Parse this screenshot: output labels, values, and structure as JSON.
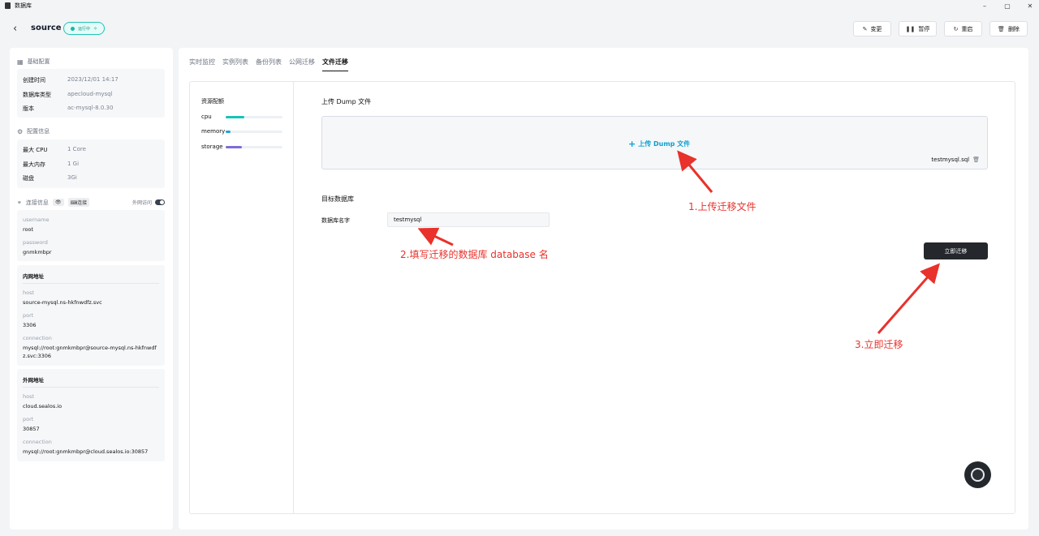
{
  "window": {
    "title": "数据库",
    "controls": [
      "–",
      "▢",
      "✕"
    ]
  },
  "header": {
    "back": "‹",
    "name": "source",
    "status": "运行中"
  },
  "actions": [
    {
      "icon": "✎",
      "label": "变更"
    },
    {
      "icon": "❚❚",
      "label": "暂停"
    },
    {
      "icon": "↻",
      "label": "重启"
    },
    {
      "icon": "🗑",
      "label": "删除"
    }
  ],
  "sidebar": {
    "basic_title": "基础配置",
    "basic": [
      {
        "k": "创建时间",
        "v": "2023/12/01 14:17"
      },
      {
        "k": "数据库类型",
        "v": "apecloud-mysql"
      },
      {
        "k": "版本",
        "v": "ac-mysql-8.0.30"
      }
    ],
    "config_title": "配置信息",
    "config": [
      {
        "k": "最大 CPU",
        "v": "1 Core"
      },
      {
        "k": "最大内存",
        "v": "1 Gi"
      },
      {
        "k": "磁盘",
        "v": "3Gi"
      }
    ],
    "conn_title": "连接信息",
    "connect_label": "连接",
    "external_access": "外网访问",
    "creds": [
      {
        "k": "username",
        "v": "root"
      },
      {
        "k": "password",
        "v": "gnmkmbpr"
      }
    ],
    "internal_title": "内网地址",
    "internal": [
      {
        "k": "host",
        "v": "source-mysql.ns-hkfnwdfz.svc"
      },
      {
        "k": "port",
        "v": "3306"
      },
      {
        "k": "connection",
        "v": "mysql://root:gnmkmbpr@source-mysql.ns-hkfnwdfz.svc:3306"
      }
    ],
    "external_title": "外网地址",
    "external": [
      {
        "k": "host",
        "v": "cloud.sealos.io"
      },
      {
        "k": "port",
        "v": "30857"
      },
      {
        "k": "connection",
        "v": "mysql://root:gnmkmbpr@cloud.sealos.io:30857"
      }
    ]
  },
  "tabs": [
    "实时监控",
    "实例列表",
    "备份列表",
    "公网迁移",
    "文件迁移"
  ],
  "active_tab": "文件迁移",
  "resources": {
    "title": "资源配额",
    "items": [
      {
        "label": "cpu",
        "fraction": 0.33,
        "color": "#16c4b6"
      },
      {
        "label": "memory",
        "fraction": 0.08,
        "color": "#14a8dc"
      },
      {
        "label": "storage",
        "fraction": 0.29,
        "color": "#7c6cd6"
      }
    ]
  },
  "upload": {
    "title": "上传 Dump 文件",
    "link": "上传 Dump 文件",
    "file": "testmysql.sql"
  },
  "target": {
    "title": "目标数据库",
    "label": "数据库名字",
    "value": "testmysql"
  },
  "migrate_button": "立即迁移",
  "annotations": {
    "step1": "1.上传迁移文件",
    "step2": "2.填写迁移的数据库 database 名",
    "step3": "3.立即迁移",
    "color": "#e8322b"
  }
}
